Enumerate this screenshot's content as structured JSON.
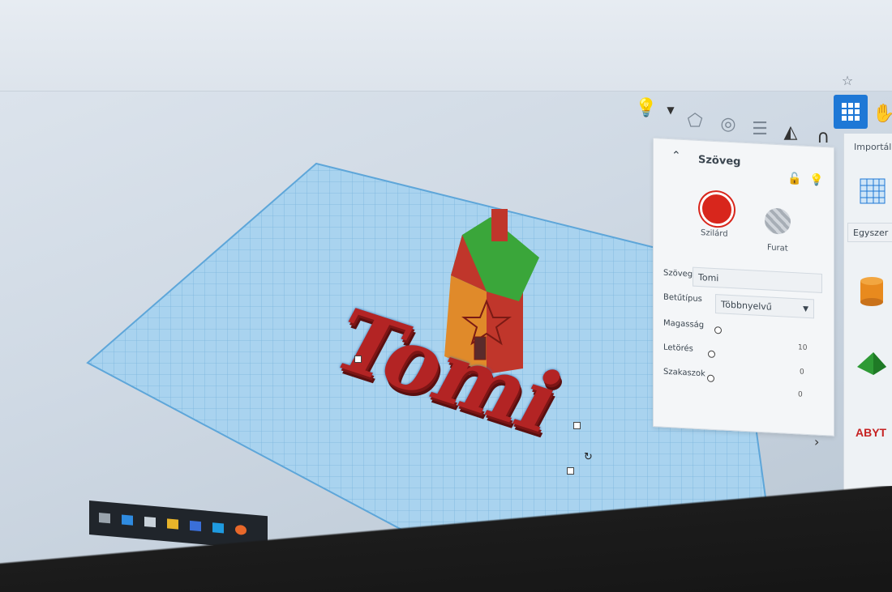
{
  "panel": {
    "title": "Szöveg",
    "solid_label": "Szilárd",
    "hole_label": "Furat",
    "text_label": "Szöveg",
    "text_value": "Tomi",
    "font_label": "Betűtípus",
    "font_value": "Többnyelvű",
    "height_label": "Magasság",
    "height_value": "10",
    "bevel_label": "Letörés",
    "bevel_value": "0",
    "segments_label": "Szakaszok",
    "segments_value": "0"
  },
  "library": {
    "import_label": "Importál",
    "category_label": "Egyszer"
  },
  "model_text": "Tomi",
  "colors": {
    "solid": "#d8261c",
    "roof": "#3aa63a",
    "accent": "#1e78d6",
    "workplane": "#8fc3e6"
  }
}
